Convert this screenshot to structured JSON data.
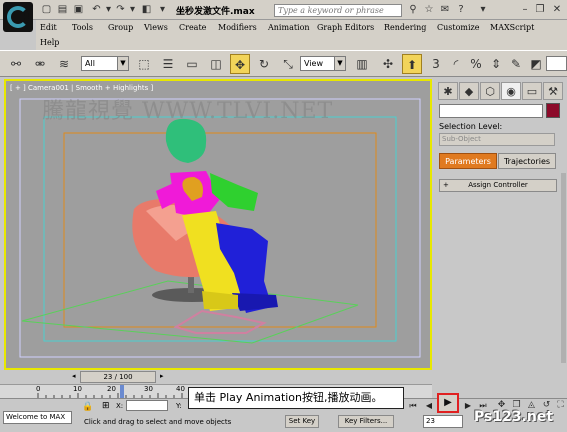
{
  "window": {
    "title": "坐秒发激文件.max",
    "search_placeholder": "Type a keyword or phrase"
  },
  "menubar": {
    "items": [
      "Edit",
      "Tools",
      "Group",
      "Views",
      "Create",
      "Modifiers",
      "Animation",
      "Graph Editors",
      "Rendering",
      "Customize",
      "MAXScript",
      "Help"
    ]
  },
  "toolbar": {
    "selection_filter": "All",
    "reference_coord": "View"
  },
  "viewport": {
    "label": "[ + ] Camera001 | Smooth + Highlights ]",
    "watermark": "騰龍視覺 WWW.TLVI.NET",
    "border_color": "#e8e800"
  },
  "command_panel": {
    "selection_level_label": "Selection Level:",
    "subobject_value": "Sub-Object",
    "tab_parameters": "Parameters",
    "tab_trajectories": "Trajectories",
    "assign_controller_label": "Assign Controller",
    "active_tab_color": "#e07a20"
  },
  "timeline": {
    "frame_display": "23 / 100",
    "ticks": [
      "0",
      "10",
      "20",
      "30",
      "40"
    ]
  },
  "status": {
    "maxscript_listener": "Welcome to MAX",
    "prompt": "Click and drag to select and move objects",
    "coord_x_label": "X:",
    "set_key_label": "Set Key",
    "key_filters_label": "Key Filters...",
    "current_frame": "23"
  },
  "callout": {
    "text": "单击 Play Animation按钮,播放动画。",
    "highlight_color": "#e02020"
  },
  "corner_logo": {
    "text": "Ps123.net"
  }
}
